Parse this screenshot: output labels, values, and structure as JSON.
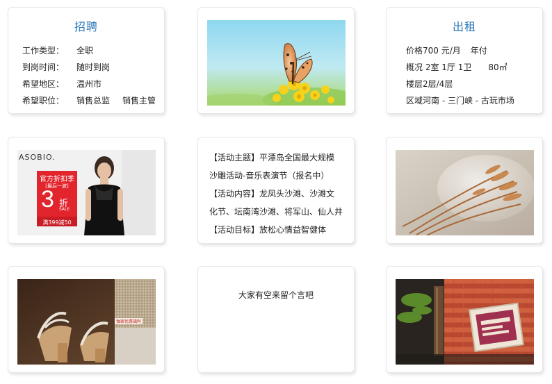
{
  "recruit": {
    "title": "招聘",
    "rows": [
      {
        "label": "工作类型：",
        "value": "全职",
        "value2": ""
      },
      {
        "label": "到岗时间：",
        "value": "随时到岗",
        "value2": ""
      },
      {
        "label": "希望地区：",
        "value": "温州市",
        "value2": ""
      },
      {
        "label": "希望职位：",
        "value": "销售总监",
        "value2": "销售主管"
      }
    ]
  },
  "rent": {
    "title": "出租",
    "price": "价格700 元/月",
    "pay": "年付",
    "overview": "概况 2室 1厅 1卫",
    "area": "80㎡",
    "floor": "楼层2层/4层",
    "region": "区域河南 - 三门峡 - 古玩市场"
  },
  "ad": {
    "brand": "ASOBIO.",
    "season": "官方折扣季",
    "tag": "[最后一波]",
    "discount": "3",
    "discount_unit": "折",
    "sale": "SALE",
    "promo": "满399减50"
  },
  "activity": {
    "lines": [
      "【活动主题】平潭岛全国最大规模",
      "沙雕活动-音乐表演节（报名中）",
      "【活动内容】龙凤头沙滩、沙滩文",
      "化节、坛南湾沙滩、将军山、仙人井",
      "【活动目标】放松心情益智健体"
    ]
  },
  "message": {
    "text": "大家有空来留个言吧"
  },
  "shoe_label": "独家优惠福利"
}
